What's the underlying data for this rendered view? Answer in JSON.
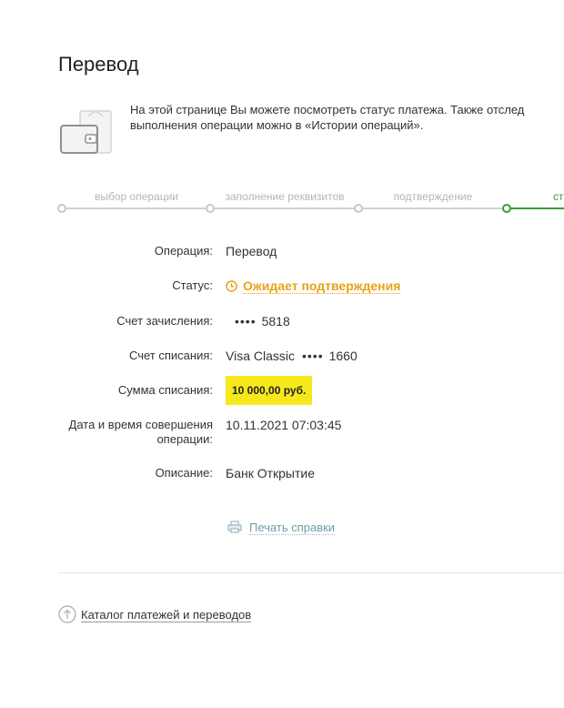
{
  "page": {
    "title": "Перевод",
    "info_line1": "На этой странице Вы можете посмотреть статус платежа. Также отслед",
    "info_line2": "выполнения операции можно в «Истории операций»."
  },
  "steps": [
    {
      "label": "выбор операции",
      "active": false
    },
    {
      "label": "заполнение реквизитов",
      "active": false
    },
    {
      "label": "подтверждение",
      "active": false
    },
    {
      "label": "статус",
      "active": true
    }
  ],
  "details": {
    "operation_label": "Операция:",
    "operation_value": "Перевод",
    "status_label": "Статус:",
    "status_value": "Ожидает подтверждения",
    "credit_account_label": "Счет зачисления:",
    "credit_account_mask": "••••",
    "credit_account_number": "5818",
    "debit_account_label": "Счет списания:",
    "debit_card_type": "Visa Classic",
    "debit_account_mask": "••••",
    "debit_account_number": "1660",
    "amount_label": "Сумма списания:",
    "amount_value": "10 000,00 руб.",
    "datetime_label_line1": "Дата и время совершения",
    "datetime_label_line2": "операции:",
    "datetime_value": "10.11.2021 07:03:45",
    "description_label": "Описание:",
    "description_value": "Банк Открытие"
  },
  "actions": {
    "print_label": "Печать справки",
    "catalog_label": "Каталог платежей и переводов"
  },
  "colors": {
    "accent_green": "#3e9b34",
    "status_orange": "#e8a317",
    "amount_highlight": "#f6e81c",
    "link_blue": "#6e9ea8"
  },
  "icons": [
    "wallet-icon",
    "clock-icon",
    "printer-icon",
    "arrow-up-circle-icon"
  ]
}
